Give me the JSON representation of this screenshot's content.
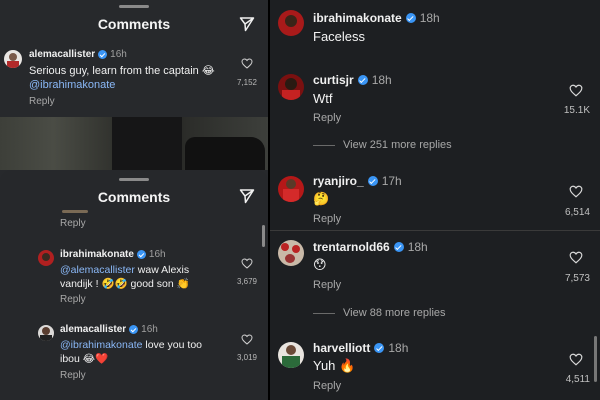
{
  "left_top": {
    "title": "Comments",
    "comment": {
      "username": "alemacallister",
      "time": "16h",
      "text": "Serious guy, learn from the captain",
      "emoji": "😂",
      "mention": "@ibrahimakonate",
      "likes": "7,152",
      "reply": "Reply"
    }
  },
  "left_bottom": {
    "title": "Comments",
    "partial_reply": "Reply",
    "comments": [
      {
        "username": "ibrahimakonate",
        "time": "16h",
        "mention": "@alemacallister",
        "text_a": "waw Alexis",
        "text_b": "vandijk !",
        "emoji_a": "🤣🤣",
        "text_c": "good son",
        "emoji_b": "👏",
        "likes": "3,679",
        "reply": "Reply"
      },
      {
        "username": "alemacallister",
        "time": "16h",
        "mention": "@ibrahimakonate",
        "text_a": "love you too",
        "text_b": "ibou",
        "emoji_a": "😂❤️",
        "likes": "3,019",
        "reply": "Reply"
      }
    ]
  },
  "right": {
    "comments": [
      {
        "username": "ibrahimakonate",
        "time": "18h",
        "text": "Faceless",
        "likes": "",
        "reply": ""
      },
      {
        "username": "curtisjr",
        "time": "18h",
        "text": "Wtf",
        "likes": "15.1K",
        "reply": "Reply"
      },
      {
        "username": "ryanjiro_",
        "time": "17h",
        "text": "🤔",
        "likes": "6,514",
        "reply": "Reply"
      },
      {
        "username": "trentarnold66",
        "time": "18h",
        "text": "😯",
        "likes": "7,573",
        "reply": "Reply"
      },
      {
        "username": "harvelliott",
        "time": "18h",
        "text": "Yuh",
        "emoji": "🔥",
        "likes": "4,511",
        "reply": "Reply"
      }
    ],
    "view_more_1": "View 251 more replies",
    "view_more_2": "View 88 more replies"
  },
  "colors": {
    "mention": "#8ab8f7",
    "verified": "#3a95f5",
    "background": "#1d1f22"
  },
  "icons": [
    "send-icon",
    "heart-icon",
    "verified-badge-icon"
  ]
}
